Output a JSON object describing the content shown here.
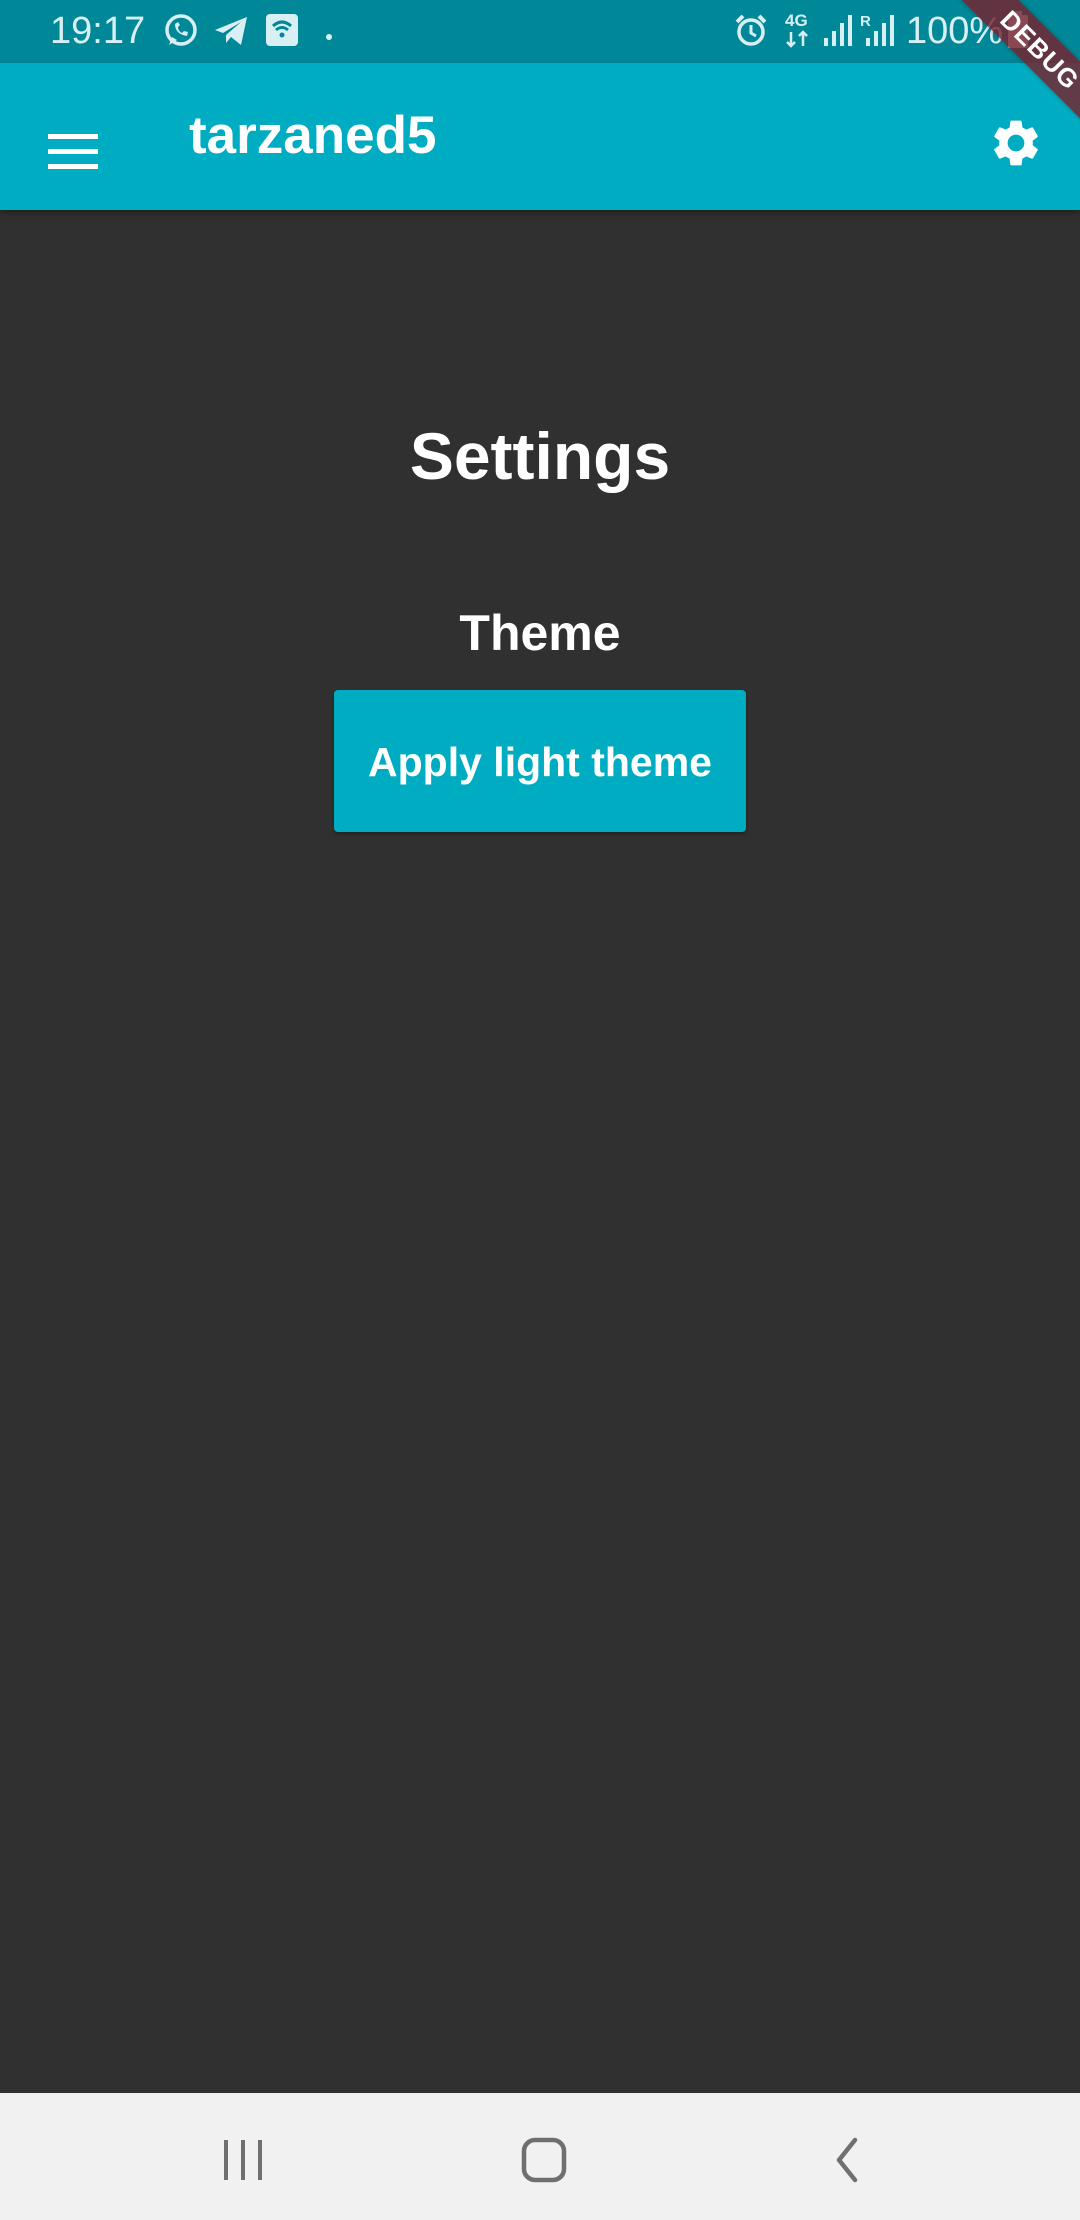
{
  "status_bar": {
    "time": "19:17",
    "battery_text": "100%",
    "network_label": "4G",
    "icons": [
      "whatsapp-icon",
      "telegram-icon",
      "wifi-call-icon",
      "dot-icon",
      "alarm-icon",
      "network-4g-icon",
      "signal-icon",
      "roaming-signal-icon",
      "battery-icon"
    ]
  },
  "app_bar": {
    "title": "tarzaned5",
    "menu_icon": "hamburger-menu-icon",
    "settings_icon": "gear-icon",
    "debug_banner": "DEBUG",
    "color": "#00acc1"
  },
  "content": {
    "heading": "Settings",
    "section_title": "Theme",
    "apply_button_label": "Apply light theme",
    "background": "#303030"
  },
  "nav_bar": {
    "icons": [
      "recent-apps-icon",
      "home-icon",
      "back-icon"
    ]
  }
}
